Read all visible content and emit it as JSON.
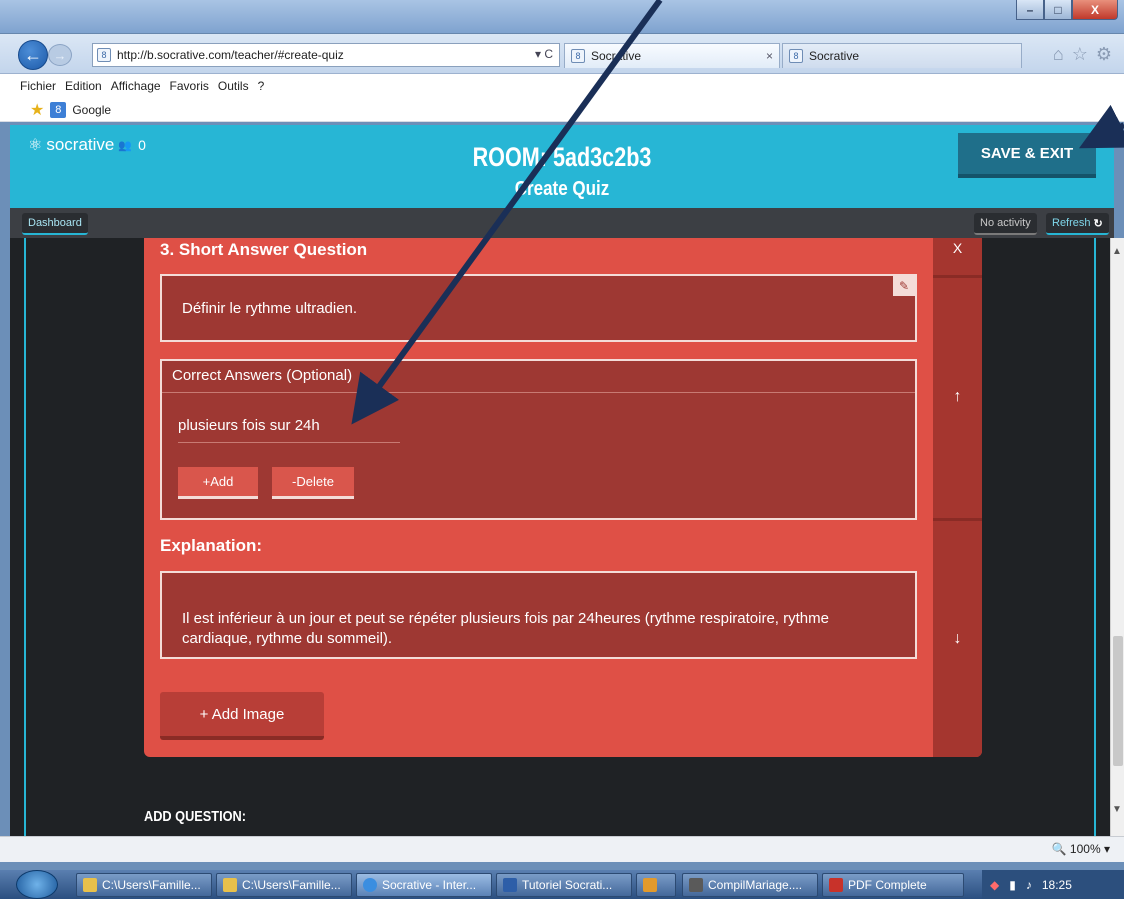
{
  "browser": {
    "window_buttons": {
      "minimize": "–",
      "maximize": "□",
      "close": "X"
    },
    "back_symbol": "←",
    "forward_symbol": "→",
    "url": "http://b.socrative.com/teacher/#create-quiz",
    "address_controls": "▾ C",
    "tabs": [
      {
        "label": "Socrative",
        "close": "×"
      },
      {
        "label": "Socrative"
      }
    ],
    "tools": [
      "⌂",
      "☆",
      "⚙"
    ],
    "menu": [
      "Fichier",
      "Edition",
      "Affichage",
      "Favoris",
      "Outils",
      "?"
    ],
    "favorites": {
      "item": "Google"
    }
  },
  "app": {
    "logo_text": "socrative",
    "student_count": "0",
    "room_title": "ROOM: 5ad3c2b3",
    "page_title": "Create Quiz",
    "save_label": "SAVE & EXIT",
    "dashboard_label": "Dashboard",
    "activity_label": "No activity",
    "refresh_label": "Refresh"
  },
  "question": {
    "title": "3. Short Answer Question",
    "text": "Définir le rythme ultradien.",
    "answers_header": "Correct Answers (Optional)",
    "answers": [
      "plusieurs fois sur 24h"
    ],
    "add_label": "+Add",
    "delete_label": "-Delete",
    "explanation_title": "Explanation:",
    "explanation": "Il est inférieur à un jour et peut se répéter plusieurs fois par 24heures (rythme respiratoire, rythme cardiaque, rythme du sommeil).",
    "add_image_label": "+ Add Image",
    "rail": {
      "delete": "X",
      "up": "↑",
      "down": "↓"
    }
  },
  "add_question_label": "ADD QUESTION:",
  "status": {
    "zoom": "100%"
  },
  "taskbar": {
    "items": [
      "C:\\Users\\Famille...",
      "C:\\Users\\Famille...",
      "Socrative - Inter...",
      "Tutoriel Socrati...",
      "",
      "CompilMariage....",
      "PDF Complete"
    ],
    "clock": "18:25"
  },
  "colors": {
    "socrative_blue": "#27b6d5",
    "card_red": "#df5046",
    "dark_red": "#9e3833"
  }
}
